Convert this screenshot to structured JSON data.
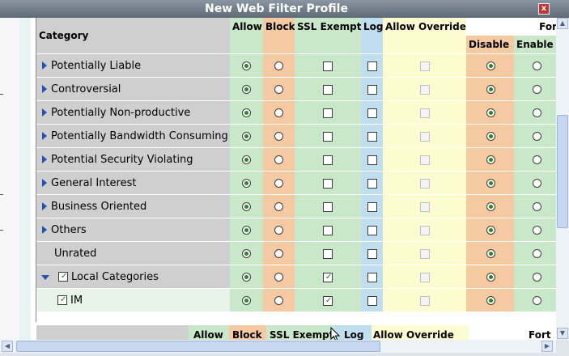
{
  "window": {
    "title": "New Web Filter Profile",
    "close_glyph": "x"
  },
  "table": {
    "header": {
      "category": "Category",
      "allow": "Allow",
      "block": "Block",
      "ssl_exempt": "SSL Exempt",
      "log": "Log",
      "allow_override": "Allow Override",
      "for": "For",
      "disable": "Disable",
      "enable": "Enable"
    },
    "rows": [
      {
        "label": "Potentially Liable",
        "expander": "right",
        "checkbox": false,
        "indent": 0,
        "allow": true,
        "ssl": false,
        "log": false,
        "fo_disable": true
      },
      {
        "label": "Controversial",
        "expander": "right",
        "checkbox": false,
        "indent": 0,
        "allow": true,
        "ssl": false,
        "log": false,
        "fo_disable": true
      },
      {
        "label": "Potentially Non-productive",
        "expander": "right",
        "checkbox": false,
        "indent": 0,
        "allow": true,
        "ssl": false,
        "log": false,
        "fo_disable": true
      },
      {
        "label": "Potentially Bandwidth Consuming",
        "expander": "right",
        "checkbox": false,
        "indent": 0,
        "allow": true,
        "ssl": false,
        "log": false,
        "fo_disable": true
      },
      {
        "label": "Potential Security Violating",
        "expander": "right",
        "checkbox": false,
        "indent": 0,
        "allow": true,
        "ssl": false,
        "log": false,
        "fo_disable": true
      },
      {
        "label": "General Interest",
        "expander": "right",
        "checkbox": false,
        "indent": 0,
        "allow": true,
        "ssl": false,
        "log": false,
        "fo_disable": true
      },
      {
        "label": "Business Oriented",
        "expander": "right",
        "checkbox": false,
        "indent": 0,
        "allow": true,
        "ssl": false,
        "log": false,
        "fo_disable": true
      },
      {
        "label": "Others",
        "expander": "right",
        "checkbox": false,
        "indent": 0,
        "allow": true,
        "ssl": false,
        "log": false,
        "fo_disable": true
      },
      {
        "label": "Unrated",
        "expander": "none",
        "checkbox": false,
        "indent": 0,
        "allow": true,
        "ssl": false,
        "log": false,
        "fo_disable": true
      },
      {
        "label": "Local Categories",
        "expander": "down",
        "checkbox": true,
        "indent": 0,
        "allow": true,
        "ssl": true,
        "log": false,
        "fo_disable": true
      },
      {
        "label": "IM",
        "expander": "none",
        "checkbox": true,
        "indent": 1,
        "allow": true,
        "ssl": true,
        "log": false,
        "fo_disable": true
      }
    ]
  },
  "bottom_header": {
    "allow": "Allow",
    "block": "Block",
    "ssl_exempt": "SSL Exempt",
    "log": "Log",
    "allow_override": "Allow Override",
    "fort": "Fort"
  },
  "colors": {
    "category_bg": "#cfcfcf",
    "allow_bg": "#c9e7c9",
    "block_bg": "#f5c9a2",
    "ssl_bg": "#c9e7c9",
    "log_bg": "#bfdff1",
    "override_bg": "#fdfbd0",
    "disable_bg": "#f5c9a2",
    "enable_bg": "#c9e7c9",
    "radio_on": "#1e8c1e"
  },
  "icons": {
    "expand": "triangle-right",
    "collapse": "triangle-down",
    "close": "close-x",
    "cursor": "mouse-pointer"
  }
}
